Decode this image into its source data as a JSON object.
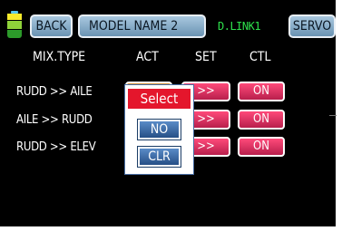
{
  "topbar": {
    "back_label": "BACK",
    "model_label": "MODEL NAME  2",
    "dlink_label": "D.LINK1",
    "servo_label": "SERVO"
  },
  "columns": {
    "mix_type": "MIX.TYPE",
    "act": "ACT",
    "set": "SET",
    "ctl": "CTL"
  },
  "rows": [
    {
      "label": "RUDD  >>  AILE",
      "set": ">>",
      "ctl": "ON"
    },
    {
      "label": "AILE  >>  RUDD",
      "set": ">>",
      "ctl": "ON"
    },
    {
      "label": "RUDD  >>  ELEV",
      "set": ">>",
      "ctl": "ON"
    }
  ],
  "popup": {
    "title": "Select",
    "options": [
      "NO",
      "CLR"
    ]
  },
  "colors": {
    "screen_bg": "#000000",
    "button_red": "#e0305e",
    "popup_title": "#e4162c",
    "popup_button": "#3e6fa8",
    "dlink_green": "#2ee04c"
  }
}
